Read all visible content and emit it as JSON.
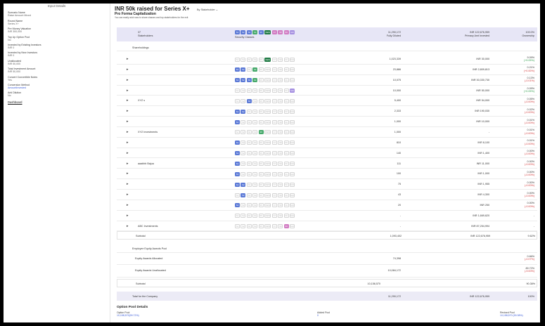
{
  "sidebar": {
    "title": "Input Details",
    "fields": [
      {
        "label": "Scenario Name",
        "value": "Raise Amount Mixed",
        "link": false
      },
      {
        "label": "Round Name",
        "value": "Series X+",
        "link": false
      },
      {
        "label": "Pre Money Valuation",
        "value": "INR 300,000",
        "link": false
      },
      {
        "label": "Top Up Option Pool",
        "value": "No",
        "link": false
      },
      {
        "label": "Invested by Existing Investors",
        "value": "INR 0",
        "link": false
      },
      {
        "label": "Invested by New Investors",
        "value": "INR 0",
        "link": false
      },
      {
        "label": "Unallocated",
        "value": "INR 50,000",
        "link": false
      },
      {
        "label": "Total Investment Amount",
        "value": "INR 50,000",
        "link": false
      },
      {
        "label": "Convert Convertible Notes",
        "value": "Yes",
        "link": false
      },
      {
        "label": "Conversion Method",
        "value": "AmountInvested",
        "link": true
      },
      {
        "label": "Anti Dilution",
        "value": "No",
        "link": false
      }
    ],
    "dashboard_link": "Dashboard"
  },
  "header": {
    "title": "INR 50k raised for Series X+",
    "selector": "By Stakeholder"
  },
  "proforma": {
    "title": "Pro Forma Capitalization",
    "subtitle": "You can easily add rows to share classes and top stakeholders for the exit"
  },
  "table_head": {
    "count": "37",
    "stakeholders_label": "Stakeholders",
    "security_label": "Security Classes",
    "fully_diluted_value": "11,290,172",
    "fully_diluted_label": "Fully Diluted",
    "amount_value": "INR 122,676,959",
    "amount_label": "Primary Amt Invested",
    "ownership_value": "100.0%",
    "ownership_label": "Ownership"
  },
  "chip_labels": [
    "S1",
    "S2",
    "S3",
    "S4",
    "S5",
    "NEW",
    "S7",
    "S8",
    "S9",
    "S10"
  ],
  "section_shareholdings": "Shareholdings",
  "rows": [
    {
      "name": "",
      "chips": [
        "off",
        "off",
        "off",
        "off",
        "off",
        "darkgreen",
        "off",
        "off",
        "off",
        "off"
      ],
      "fd": "1,023,339",
      "amt": "INR 30,000",
      "own1": "9.09%",
      "own2": "(+9.09%)",
      "own2_class": "pos"
    },
    {
      "name": "",
      "chips": [
        "blue",
        "blue",
        "off",
        "green",
        "off",
        "off",
        "off",
        "off",
        "off",
        "off"
      ],
      "fd": "23,886",
      "amt": "INR 2,809,813",
      "own1": "0.21%",
      "own2": "(+0.00%)",
      "own2_class": "neg"
    },
    {
      "name": "",
      "chips": [
        "blue",
        "blue",
        "blue",
        "green",
        "off",
        "off",
        "off",
        "off",
        "off",
        "off"
      ],
      "fd": "10,075",
      "amt": "INR 30,330,730",
      "own1": "0.13%",
      "own2": "(-0.01%)",
      "own2_class": "neg"
    },
    {
      "name": "",
      "chips": [
        "off",
        "off",
        "off",
        "off",
        "off",
        "off",
        "off",
        "off",
        "off",
        "purple"
      ],
      "fd": "10,000",
      "amt": "INR 50,000",
      "own1": "0.09%",
      "own2": "(+0.09%)",
      "own2_class": "pos"
    },
    {
      "name": "XYZ s",
      "chips": [
        "off",
        "off",
        "blue",
        "off",
        "off",
        "off",
        "off",
        "off",
        "off",
        "off"
      ],
      "fd": "5,400",
      "amt": "INR 54,000",
      "own1": "0.05%",
      "own2": "(-0.00%)",
      "own2_class": "neg"
    },
    {
      "name": "",
      "chips": [
        "blue",
        "blue",
        "off",
        "off",
        "off",
        "off",
        "off",
        "off",
        "off",
        "off"
      ],
      "fd": "2,333",
      "amt": "INR 190,030",
      "own1": "0.02%",
      "own2": "(-0.00%)",
      "own2_class": "neg"
    },
    {
      "name": "",
      "chips": [
        "blue",
        "off",
        "off",
        "off",
        "off",
        "off",
        "off",
        "off",
        "off",
        "off"
      ],
      "fd": "1,000",
      "amt": "INR 10,000",
      "own1": "0.01%",
      "own2": "(-0.00%)",
      "own2_class": "neg"
    },
    {
      "name": "XYZ Investments",
      "chips": [
        "off",
        "off",
        "off",
        "off",
        "green",
        "off",
        "off",
        "off",
        "off",
        "off"
      ],
      "fd": "1,000",
      "amt": "-",
      "own1": "0.01%",
      "own2": "(-0.00%)",
      "own2_class": "neg"
    },
    {
      "name": "",
      "chips": [
        "blue",
        "off",
        "off",
        "off",
        "off",
        "off",
        "off",
        "off",
        "off",
        "off"
      ],
      "fd": "810",
      "amt": "INR 8,100",
      "own1": "0.01%",
      "own2": "(-0.00%)",
      "own2_class": "neg"
    },
    {
      "name": "",
      "chips": [
        "blue",
        "off",
        "off",
        "off",
        "off",
        "off",
        "off",
        "off",
        "off",
        "off"
      ],
      "fd": "140",
      "amt": "INR 1,400",
      "own1": "0.00%",
      "own2": "(-0.00%)",
      "own2_class": "neg"
    },
    {
      "name": "aaabbb Bajua",
      "chips": [
        "blue",
        "off",
        "off",
        "off",
        "off",
        "off",
        "off",
        "off",
        "off",
        "off"
      ],
      "fd": "111",
      "amt": "INR 11,000",
      "own1": "0.00%",
      "own2": "(-0.00%)",
      "own2_class": "neg"
    },
    {
      "name": "",
      "chips": [
        "blue",
        "off",
        "off",
        "off",
        "off",
        "off",
        "off",
        "off",
        "off",
        "off"
      ],
      "fd": "100",
      "amt": "INR 1,000",
      "own1": "0.00%",
      "own2": "(-0.00%)",
      "own2_class": "neg"
    },
    {
      "name": "",
      "chips": [
        "blue",
        "blue",
        "off",
        "off",
        "off",
        "off",
        "off",
        "off",
        "off",
        "off"
      ],
      "fd": "75",
      "amt": "INR 1,955",
      "own1": "0.00%",
      "own2": "(-0.00%)",
      "own2_class": "neg"
    },
    {
      "name": "",
      "chips": [
        "off",
        "blue",
        "off",
        "off",
        "off",
        "off",
        "off",
        "off",
        "off",
        "off"
      ],
      "fd": "43",
      "amt": "INR 4,300",
      "own1": "0.00%",
      "own2": "(-0.00%)",
      "own2_class": "neg"
    },
    {
      "name": "",
      "chips": [
        "blue",
        "off",
        "off",
        "off",
        "off",
        "off",
        "off",
        "off",
        "off",
        "off"
      ],
      "fd": "20",
      "amt": "INR 250",
      "own1": "0.00%",
      "own2": "(-0.00%)",
      "own2_class": "neg"
    },
    {
      "name": "",
      "chips": [
        "off",
        "off",
        "off",
        "off",
        "off",
        "off",
        "off",
        "off",
        "off",
        "off"
      ],
      "fd": "-",
      "amt": "INR 1,669,620",
      "own1": "-",
      "own2": "",
      "own2_class": "neg"
    },
    {
      "name": "ABC Investments",
      "chips": [
        "off",
        "off",
        "off",
        "off",
        "off",
        "off",
        "off",
        "off",
        "pink",
        "off"
      ],
      "fd": "-",
      "amt": "INR 87,254,994",
      "own1": "-",
      "own2": "",
      "own2_class": "neg"
    }
  ],
  "subtotal1": {
    "label": "Subtotal",
    "fd": "1,093,402",
    "amt": "INR 122,676,959",
    "own": "9.62%"
  },
  "pool": {
    "title": "Employee Equity Awards Pool",
    "allocated": {
      "label": "Equity Awards Allocated",
      "fd": "74,398",
      "own1": "0.66%",
      "own2": "(-0.07%)"
    },
    "unallocated": {
      "label": "Equity Awards Unallocated",
      "fd": "10,084,172",
      "own1": "89.72%",
      "own2": "(-9.00%)"
    },
    "subtotal": {
      "label": "Subtotal",
      "fd": "10,158,570",
      "own": "90.38%"
    }
  },
  "total": {
    "label": "Total for the Company",
    "fd": "11,290,172",
    "amt": "INR 122,676,959",
    "own": "100%"
  },
  "option_pool": {
    "title": "Option Pool Details",
    "cols": [
      {
        "label": "Option Pool",
        "value": "10,158,570(99.72%)"
      },
      {
        "label": "Added Pool",
        "value": "0"
      },
      {
        "label": "Revised Pool",
        "value": "10,158,570 (90.38%)"
      }
    ]
  }
}
